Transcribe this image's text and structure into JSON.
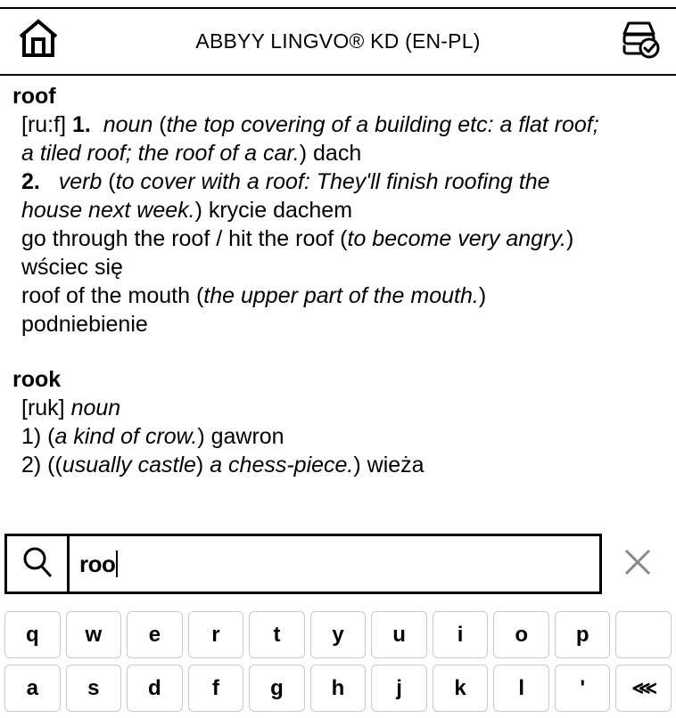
{
  "header": {
    "home_icon": "home-icon",
    "title": "ABBYY LINGVO® KD (EN-PL)",
    "dictionary_icon": "dictionary-check-icon"
  },
  "article": {
    "entries": [
      {
        "headword": "roof",
        "lines": [
          "[ru:f] 1.  noun (the top covering of a building etc: a flat roof;",
          "a tiled roof; the roof of a car.) dach",
          "2.   verb (to cover with a roof: They'll finish roofing the",
          "house next week.) krycie dachem",
          "go through the roof / hit the roof (to become very angry.)",
          "wściec się",
          "roof of the mouth (the upper part of the mouth.)",
          "podniebienie"
        ]
      },
      {
        "headword": "rook",
        "lines": [
          "[ruk] noun",
          "1) (a kind of crow.) gawron",
          "2) ((usually castle) a chess-piece.) wieża"
        ]
      }
    ]
  },
  "search": {
    "icon": "magnifier-icon",
    "value": "roo",
    "clear_icon": "close-x-icon"
  },
  "keyboard": {
    "rows": [
      [
        "q",
        "w",
        "e",
        "r",
        "t",
        "y",
        "u",
        "i",
        "o",
        "p",
        ""
      ],
      [
        "a",
        "s",
        "d",
        "f",
        "g",
        "h",
        "j",
        "k",
        "l",
        "'",
        "⋘"
      ]
    ]
  },
  "colors": {
    "text": "#000000",
    "background": "#ffffff",
    "key_border": "#c9c9c9",
    "clear_icon": "#8a8a8a"
  }
}
